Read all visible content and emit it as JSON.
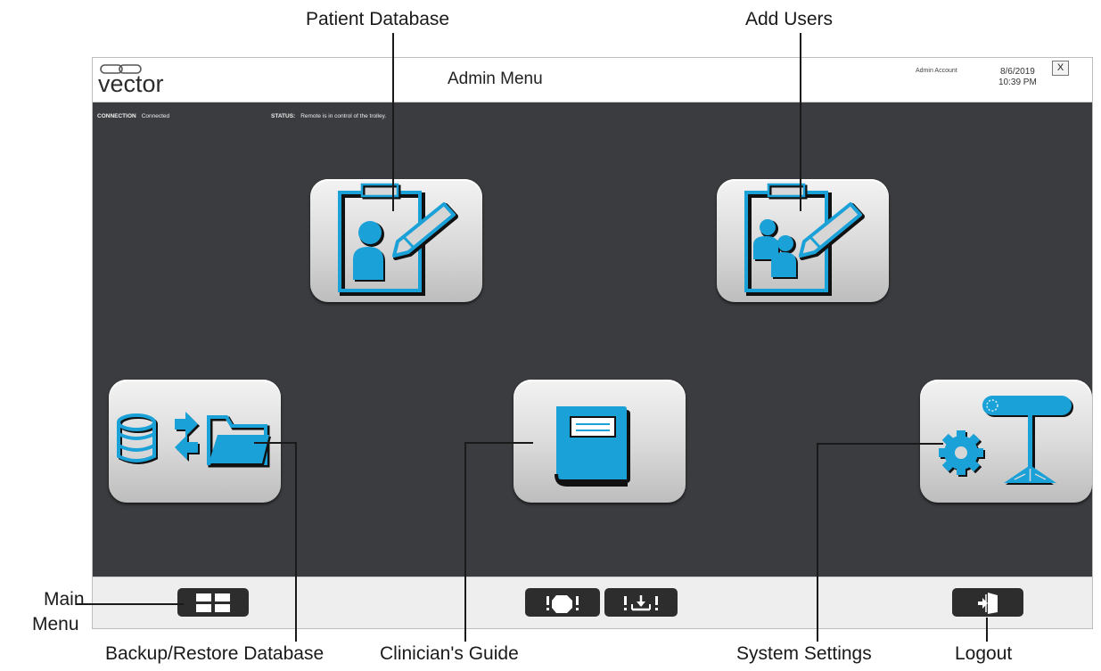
{
  "callouts": {
    "patient_database": "Patient Database",
    "add_users": "Add Users",
    "main_menu_line1": "Main",
    "main_menu_line2": "Menu",
    "backup_restore": "Backup/Restore Database",
    "clinicians_guide": "Clinician's Guide",
    "system_settings": "System Settings",
    "logout": "Logout"
  },
  "header": {
    "logo_text": "vector",
    "title": "Admin Menu",
    "account": "Admin Account",
    "date": "8/6/2019",
    "time": "10:39 PM",
    "close_label": "X"
  },
  "status": {
    "connection_label": "CONNECTION",
    "connection_value": "Connected",
    "status_label": "STATUS:",
    "status_value": "Remote is in control of the trolley."
  },
  "icons": {
    "patient_database": "clipboard-person-pencil-icon",
    "add_users": "clipboard-two-people-pencil-icon",
    "backup_restore": "database-transfer-folder-icon",
    "clinicians_guide": "book-icon",
    "system_settings": "gear-trolley-icon",
    "main_menu": "grid-icon",
    "stop": "stop-icon",
    "lower": "lower-icon",
    "logout": "logout-door-icon"
  },
  "colors": {
    "accent": "#1aa1d8",
    "screen_bg": "#3a3c3f",
    "tile": "#d6d6d6",
    "button_dark": "#2d2d2d"
  }
}
